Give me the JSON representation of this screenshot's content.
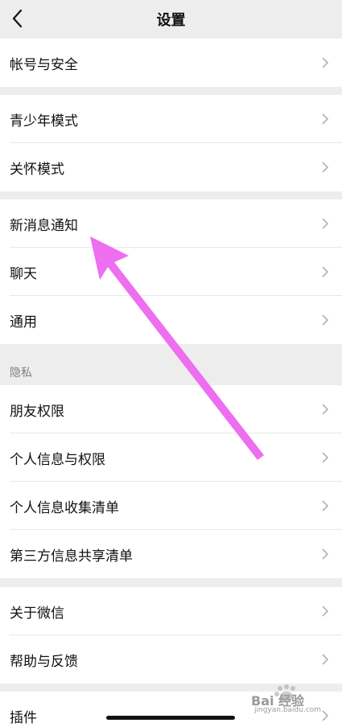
{
  "header": {
    "title": "设置"
  },
  "groups": [
    {
      "items": [
        "帐号与安全"
      ]
    },
    {
      "items": [
        "青少年模式",
        "关怀模式"
      ]
    },
    {
      "items": [
        "新消息通知",
        "聊天",
        "通用"
      ]
    },
    {
      "section_title": "隐私",
      "items": [
        "朋友权限",
        "个人信息与权限",
        "个人信息收集清单",
        "第三方信息共享清单"
      ]
    },
    {
      "items": [
        "关于微信",
        "帮助与反馈"
      ]
    },
    {
      "items": [
        "插件"
      ]
    }
  ],
  "annotation": {
    "color": "#ee6ef0"
  },
  "watermark": {
    "logo_text": "Bai 经验",
    "sub_text": "jingyan.baidu.com"
  },
  "colors": {
    "background": "#ededed",
    "row_bg": "#ffffff",
    "separator": "#e8e8e8"
  }
}
